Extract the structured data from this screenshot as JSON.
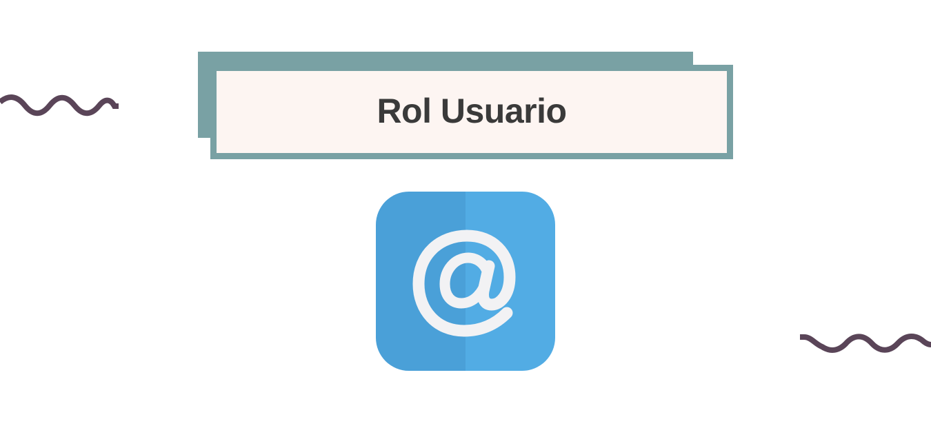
{
  "slide": {
    "title": "Rol Usuario",
    "icon": "at-sign-email-icon",
    "decorations": [
      "squiggle-line",
      "squiggle-line"
    ]
  },
  "colors": {
    "background": "#ffffff",
    "title_frame": "#79a1a4",
    "title_fill": "#fdf5f2",
    "title_text": "#3a3a3a",
    "squiggle": "#5a4558",
    "icon_blue_dark": "#4aa0d8",
    "icon_blue_light": "#52ace4",
    "icon_glyph": "#f2f2f4"
  }
}
